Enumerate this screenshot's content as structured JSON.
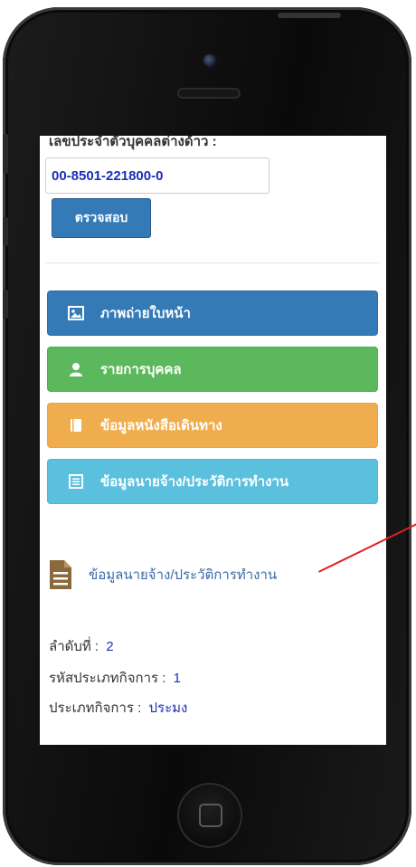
{
  "form": {
    "id_label": "เลขประจำตัวบุคคลต่างด้าว :",
    "id_value": "00-8501-221800-0",
    "check_button": "ตรวจสอบ"
  },
  "menu": [
    {
      "label": "ภาพถ่ายใบหน้า",
      "icon": "image-icon",
      "color": "#337ab7"
    },
    {
      "label": "รายการบุคคล",
      "icon": "user-icon",
      "color": "#5cb85c"
    },
    {
      "label": "ข้อมูลหนังสือเดินทาง",
      "icon": "book-icon",
      "color": "#f0ad4e"
    },
    {
      "label": "ข้อมูลนายจ้าง/ประวัติการทำงาน",
      "icon": "list-icon",
      "color": "#5bc0de"
    }
  ],
  "detail": {
    "heading": "ข้อมูลนายจ้าง/ประวัติการทำงาน",
    "rows": [
      {
        "label": "ลำดับที่ :",
        "value": "2"
      },
      {
        "label": "รหัสประเภทกิจการ :",
        "value": "1"
      },
      {
        "label": "ประเภทกิจการ :",
        "value": "ประมง"
      }
    ]
  },
  "colors": {
    "annotation": "#e02020",
    "value_text": "#1a2fb8"
  }
}
